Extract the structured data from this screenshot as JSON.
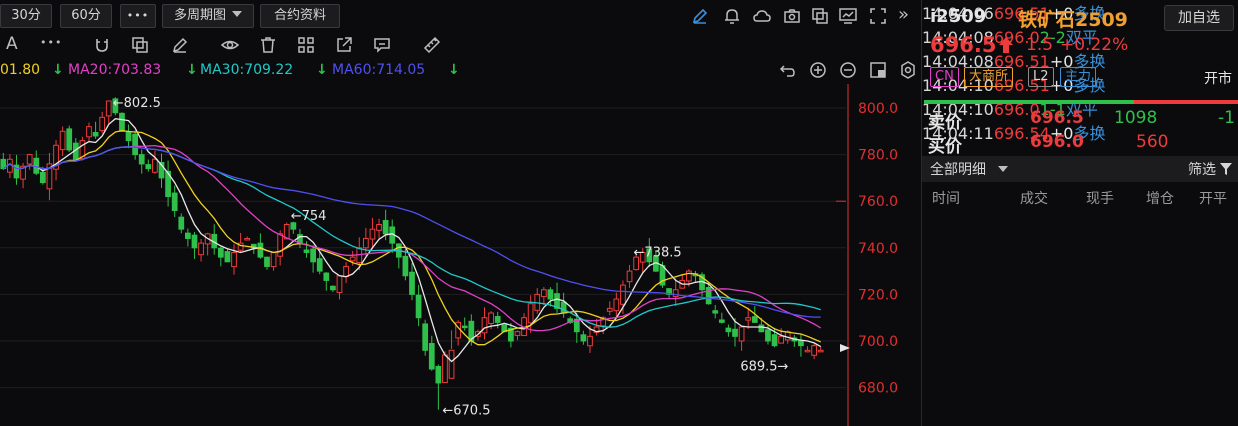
{
  "toolbar": {
    "period_30": "30分",
    "period_60": "60分",
    "more": "•••",
    "multi_period": "多周期图",
    "contract_info": "合约资料",
    "collapse": "»"
  },
  "toolbar2": {
    "text_tool": "A",
    "more_tool": "•••"
  },
  "legend": {
    "ma10": "01.80",
    "ma20": "MA20:703.83",
    "ma30": "MA30:709.22",
    "ma60": "MA60:714.05"
  },
  "colors": {
    "up": "#ee3b3b",
    "down": "#2ec04a",
    "ma5": "#e8e8e8",
    "ma10": "#f0d020",
    "ma20": "#e040c8",
    "ma30": "#20c8c8",
    "ma60": "#5050f0",
    "axis": "#e03030"
  },
  "chart_data": {
    "type": "candlestick",
    "y_ticks": [
      "800.0",
      "780.0",
      "760.0",
      "740.0",
      "720.0",
      "700.0",
      "680.0"
    ],
    "ylim": [
      669,
      810
    ],
    "annotations": [
      {
        "label": "←802.5",
        "value": 802.5
      },
      {
        "label": "←754",
        "value": 754
      },
      {
        "label": "←738.5",
        "value": 738.5
      },
      {
        "label": "689.5→",
        "value": 689.5
      },
      {
        "label": "←670.5",
        "value": 670.5
      }
    ],
    "ma_lines": [
      "MA5",
      "MA10",
      "MA20",
      "MA30",
      "MA60"
    ]
  },
  "quote": {
    "symbol": "i2509",
    "name": "铁矿石2509",
    "add_watch": "加自选",
    "price": "696.5",
    "change": "1.5",
    "change_pct": "+0.22%",
    "tags": [
      "CN",
      "大商所",
      "L2",
      "主力"
    ],
    "status": "开市",
    "ask_label": "卖价",
    "ask_price": "696.5",
    "ask_vol": "1098",
    "ask_diff": "-1",
    "bid_label": "买价",
    "bid_price": "696.0",
    "bid_vol": "560",
    "detail_select": "全部明细",
    "filter": "筛选"
  },
  "ticks": {
    "headers": [
      "时间",
      "成交",
      "现手",
      "增仓",
      "开平"
    ],
    "rows": [
      {
        "time": "14:04:06",
        "price": "696.5",
        "vol": "1",
        "oi": "+0",
        "type": "多换"
      },
      {
        "time": "14:04:08",
        "price": "696.0",
        "vol": "2",
        "oi": "-2",
        "type": "双平"
      },
      {
        "time": "14:04:08",
        "price": "696.5",
        "vol": "1",
        "oi": "+0",
        "type": "多换"
      },
      {
        "time": "14:04:10",
        "price": "696.5",
        "vol": "1",
        "oi": "+0",
        "type": "多换"
      },
      {
        "time": "14:04:10",
        "price": "696.0",
        "vol": "1",
        "oi": "-1",
        "type": "双平"
      },
      {
        "time": "14:04:11",
        "price": "696.5",
        "vol": "4",
        "oi": "+0",
        "type": "多换"
      }
    ]
  }
}
